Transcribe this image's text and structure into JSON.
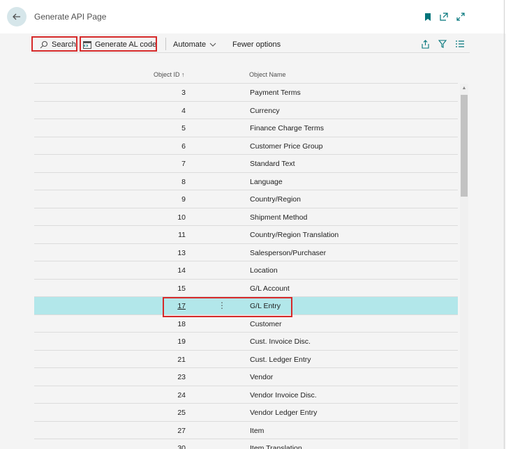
{
  "header": {
    "title": "Generate API Page",
    "icons": [
      "back-arrow-icon",
      "bookmark-icon",
      "open-new-window-icon",
      "expand-icon"
    ],
    "accent_color": "#00747a"
  },
  "toolbar": {
    "search_label": "Search",
    "generate_label": "Generate AL code",
    "automate_label": "Automate",
    "fewer_options_label": "Fewer options"
  },
  "columns": {
    "object_id": "Object ID ↑",
    "object_name": "Object Name"
  },
  "rows": [
    {
      "id": "3",
      "name": "Payment Terms"
    },
    {
      "id": "4",
      "name": "Currency"
    },
    {
      "id": "5",
      "name": "Finance Charge Terms"
    },
    {
      "id": "6",
      "name": "Customer Price Group"
    },
    {
      "id": "7",
      "name": "Standard Text"
    },
    {
      "id": "8",
      "name": "Language"
    },
    {
      "id": "9",
      "name": "Country/Region"
    },
    {
      "id": "10",
      "name": "Shipment Method"
    },
    {
      "id": "11",
      "name": "Country/Region Translation"
    },
    {
      "id": "13",
      "name": "Salesperson/Purchaser"
    },
    {
      "id": "14",
      "name": "Location"
    },
    {
      "id": "15",
      "name": "G/L Account"
    },
    {
      "id": "17",
      "name": "G/L Entry",
      "selected": true
    },
    {
      "id": "18",
      "name": "Customer"
    },
    {
      "id": "19",
      "name": "Cust. Invoice Disc."
    },
    {
      "id": "21",
      "name": "Cust. Ledger Entry"
    },
    {
      "id": "23",
      "name": "Vendor"
    },
    {
      "id": "24",
      "name": "Vendor Invoice Disc."
    },
    {
      "id": "25",
      "name": "Vendor Ledger Entry"
    },
    {
      "id": "27",
      "name": "Item"
    },
    {
      "id": "30",
      "name": "Item Translation"
    }
  ],
  "row_actions_glyph": "⋮"
}
